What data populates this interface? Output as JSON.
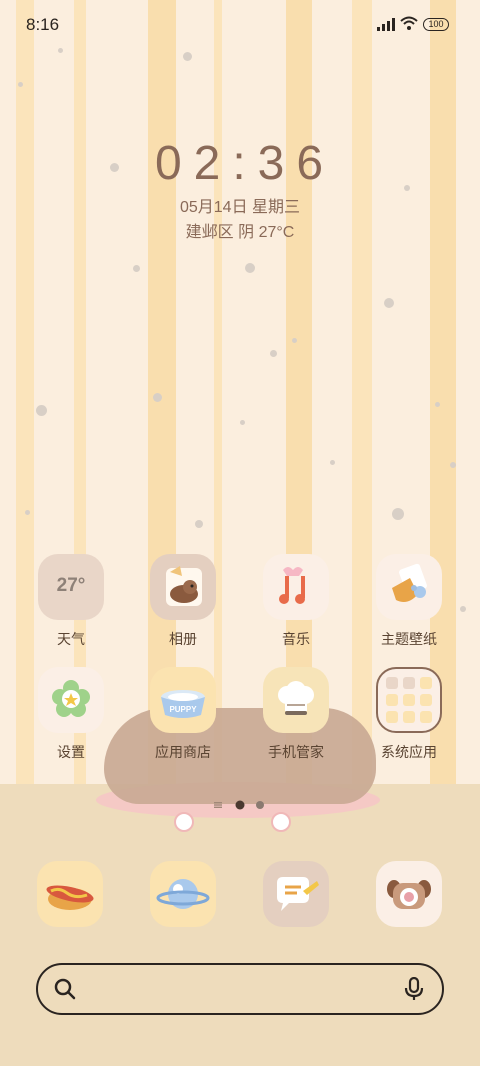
{
  "status_bar": {
    "time": "8:16",
    "battery": "100"
  },
  "clock": {
    "time": "02:36",
    "date": "05月14日 星期三",
    "weather": "建邺区 阴 27°C"
  },
  "apps": [
    {
      "label": "天气",
      "icon": "weather-icon",
      "value": "27°"
    },
    {
      "label": "相册",
      "icon": "gallery-icon"
    },
    {
      "label": "音乐",
      "icon": "music-icon"
    },
    {
      "label": "主题壁纸",
      "icon": "theme-icon"
    },
    {
      "label": "设置",
      "icon": "settings-icon"
    },
    {
      "label": "应用商店",
      "icon": "app-store-icon",
      "badge": "PUPPY"
    },
    {
      "label": "手机管家",
      "icon": "phone-manager-icon"
    },
    {
      "label": "系统应用",
      "icon": "system-apps-folder-icon"
    }
  ],
  "dock": [
    {
      "icon": "hotdog-phone-icon"
    },
    {
      "icon": "planet-browser-icon"
    },
    {
      "icon": "chat-messages-icon"
    },
    {
      "icon": "dog-camera-icon"
    }
  ],
  "page_indicator": {
    "pages": 2,
    "current": 1
  },
  "colors": {
    "accent_text": "#8a6a58",
    "label_text": "#5a4432"
  }
}
